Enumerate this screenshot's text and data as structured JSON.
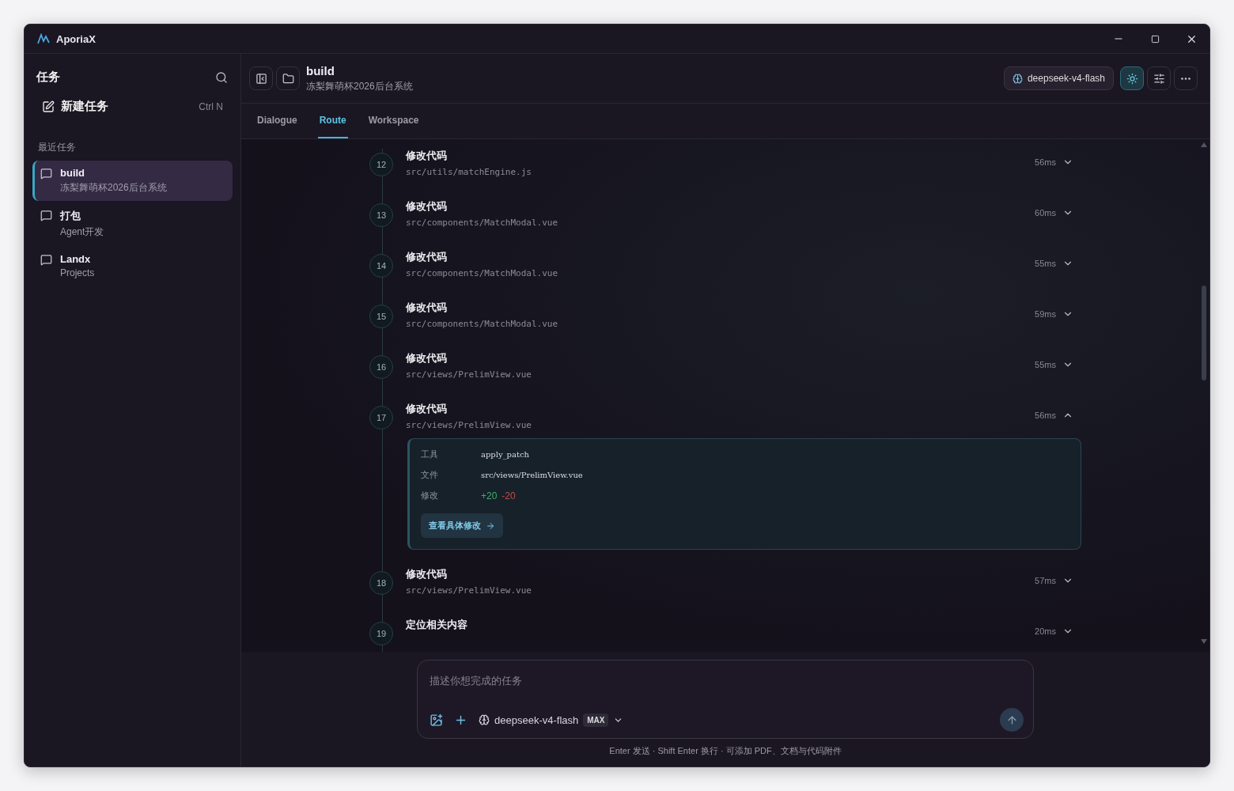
{
  "window": {
    "title": "AporiaX"
  },
  "sidebar": {
    "title": "任务",
    "new_task": {
      "label": "新建任务",
      "shortcut": "Ctrl N"
    },
    "section": "最近任务",
    "items": [
      {
        "title": "build",
        "subtitle": "冻梨舞萌杯2026后台系统",
        "selected": true
      },
      {
        "title": "打包",
        "subtitle": "Agent开发",
        "selected": false
      },
      {
        "title": "Landx",
        "subtitle": "Projects",
        "selected": false
      }
    ]
  },
  "header": {
    "title": "build",
    "subtitle": "冻梨舞萌杯2026后台系统",
    "model": "deepseek-v4-flash"
  },
  "tabs": [
    {
      "label": "Dialogue",
      "selected": false
    },
    {
      "label": "Route",
      "selected": true
    },
    {
      "label": "Workspace",
      "selected": false
    }
  ],
  "steps": [
    {
      "number": "12",
      "title": "修改代码",
      "path": "src/utils/matchEngine.js",
      "duration": "56ms",
      "expanded": false
    },
    {
      "number": "13",
      "title": "修改代码",
      "path": "src/components/MatchModal.vue",
      "duration": "60ms",
      "expanded": false
    },
    {
      "number": "14",
      "title": "修改代码",
      "path": "src/components/MatchModal.vue",
      "duration": "55ms",
      "expanded": false
    },
    {
      "number": "15",
      "title": "修改代码",
      "path": "src/components/MatchModal.vue",
      "duration": "59ms",
      "expanded": false
    },
    {
      "number": "16",
      "title": "修改代码",
      "path": "src/views/PrelimView.vue",
      "duration": "55ms",
      "expanded": false
    },
    {
      "number": "17",
      "title": "修改代码",
      "path": "src/views/PrelimView.vue",
      "duration": "56ms",
      "expanded": true,
      "details": {
        "rows": [
          {
            "label": "工具",
            "value": "apply_patch"
          },
          {
            "label": "文件",
            "value": "src/views/PrelimView.vue"
          }
        ],
        "change": {
          "label": "修改",
          "added": "+20",
          "removed": "-20"
        },
        "button": "查看具体修改"
      }
    },
    {
      "number": "18",
      "title": "修改代码",
      "path": "src/views/PrelimView.vue",
      "duration": "57ms",
      "expanded": false
    },
    {
      "number": "19",
      "title": "定位相关内容",
      "duration": "20ms",
      "expanded": false
    }
  ],
  "composer": {
    "placeholder": "描述你想完成的任务",
    "model": "deepseek-v4-flash",
    "badge": "MAX"
  },
  "hint": "Enter 发送 · Shift Enter 换行 · 可添加 PDF、文档与代码附件"
}
